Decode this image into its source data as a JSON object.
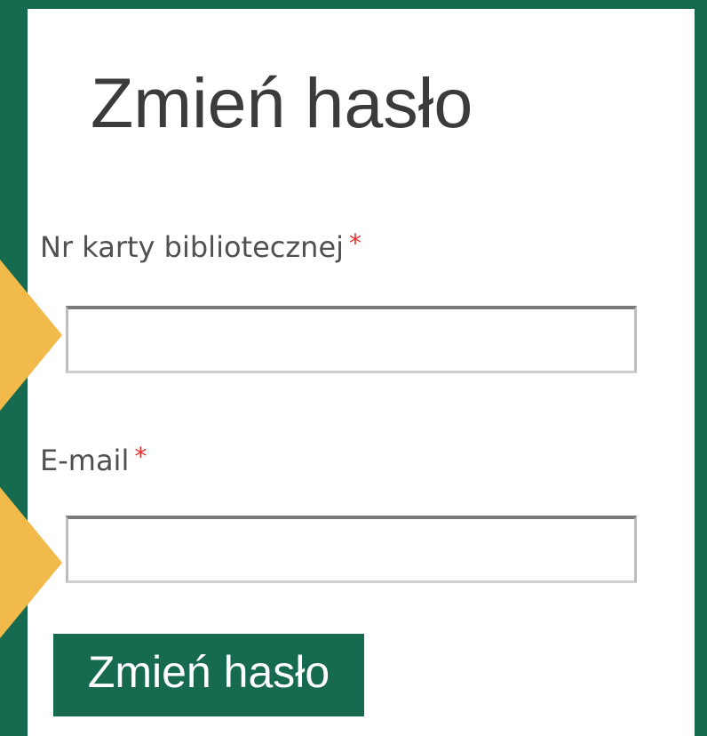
{
  "form": {
    "title": "Zmień hasło",
    "card_number": {
      "label": "Nr karty bibliotecznej",
      "required_mark": "*",
      "value": ""
    },
    "email": {
      "label": "E-mail",
      "required_mark": "*",
      "value": ""
    },
    "submit_label": "Zmień hasło"
  },
  "colors": {
    "background": "#166a4f",
    "panel": "#ffffff",
    "arrow_highlight": "#f2b94b",
    "required_mark": "#e8312f",
    "button": "#166a4f",
    "button_text": "#ffffff"
  }
}
